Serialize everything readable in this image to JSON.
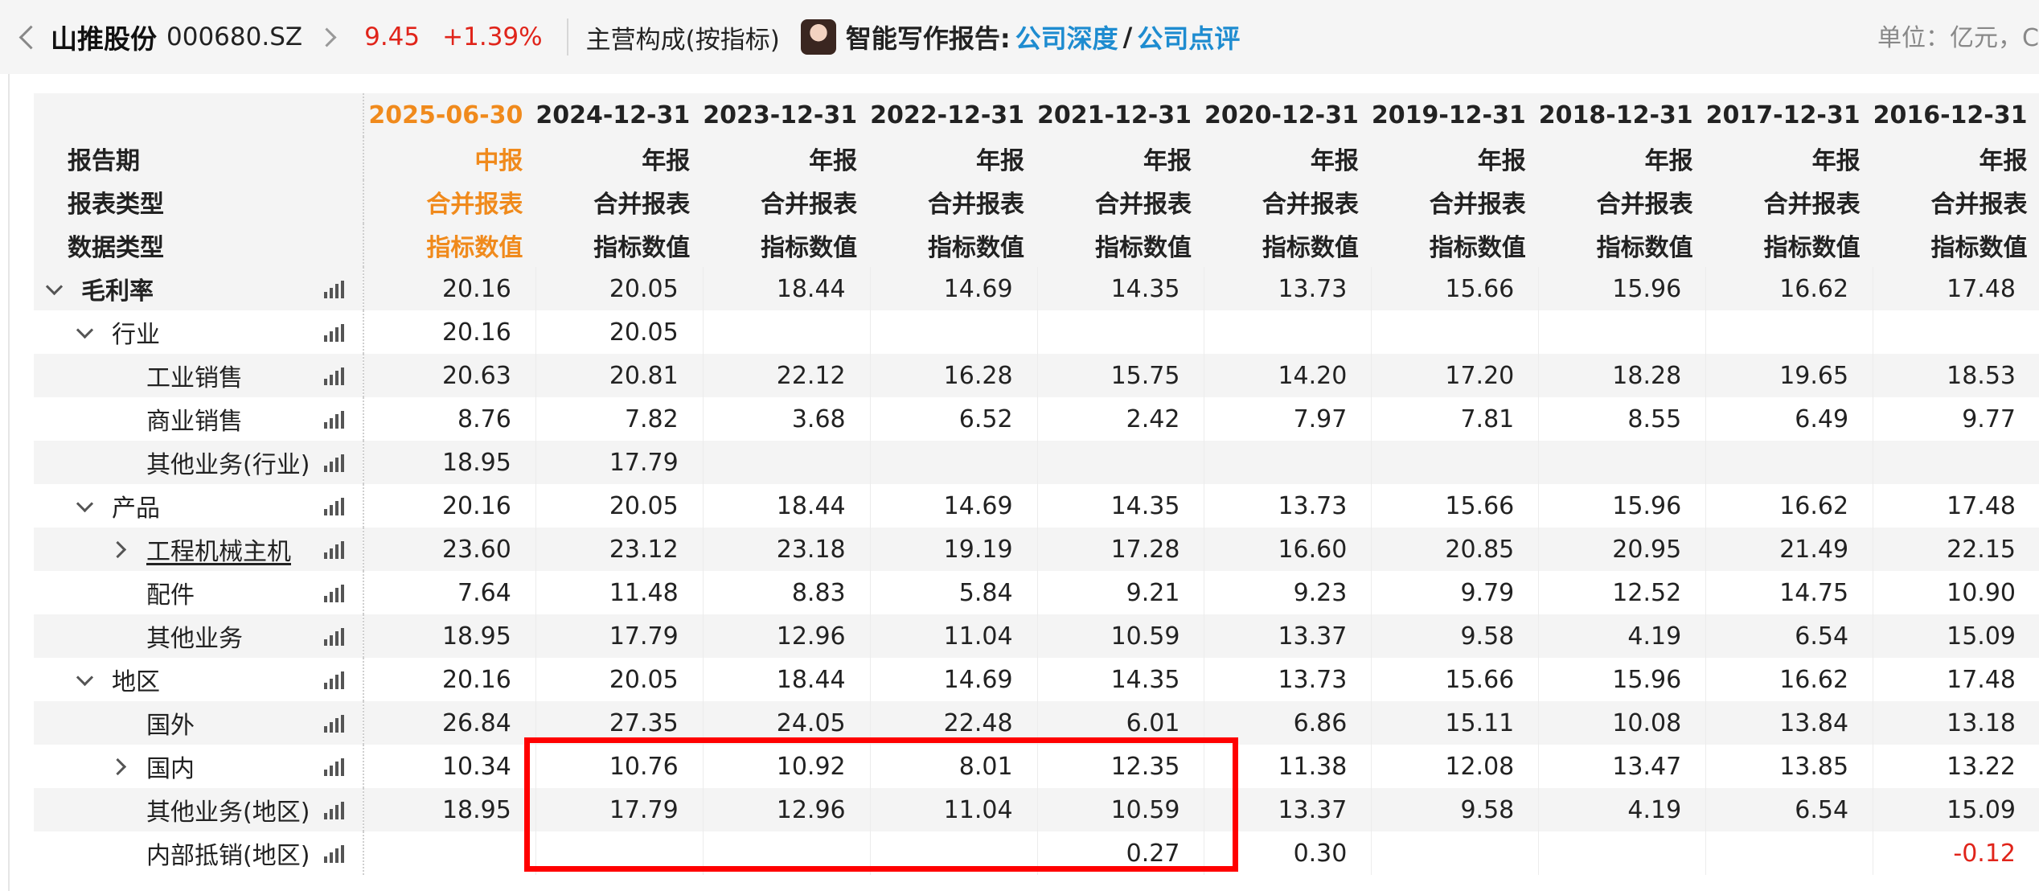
{
  "header": {
    "stock_name": "山推股份",
    "stock_code": "000680.SZ",
    "price": "9.45",
    "change_pct": "+1.39%",
    "section_title": "主营构成(按指标)",
    "ai_report_label": "智能写作报告:",
    "ai_link_1": "公司深度",
    "ai_slash": "/",
    "ai_link_2": "公司点评",
    "unit": "单位：亿元，C"
  },
  "table": {
    "row_labels": [
      "报告期",
      "报表类型",
      "数据类型"
    ],
    "periods": [
      {
        "date": "2025-06-30",
        "type": "中报",
        "statement": "合并报表",
        "data_type": "指标数值"
      },
      {
        "date": "2024-12-31",
        "type": "年报",
        "statement": "合并报表",
        "data_type": "指标数值"
      },
      {
        "date": "2023-12-31",
        "type": "年报",
        "statement": "合并报表",
        "data_type": "指标数值"
      },
      {
        "date": "2022-12-31",
        "type": "年报",
        "statement": "合并报表",
        "data_type": "指标数值"
      },
      {
        "date": "2021-12-31",
        "type": "年报",
        "statement": "合并报表",
        "data_type": "指标数值"
      },
      {
        "date": "2020-12-31",
        "type": "年报",
        "statement": "合并报表",
        "data_type": "指标数值"
      },
      {
        "date": "2019-12-31",
        "type": "年报",
        "statement": "合并报表",
        "data_type": "指标数值"
      },
      {
        "date": "2018-12-31",
        "type": "年报",
        "statement": "合并报表",
        "data_type": "指标数值"
      },
      {
        "date": "2017-12-31",
        "type": "年报",
        "statement": "合并报表",
        "data_type": "指标数值"
      },
      {
        "date": "2016-12-31",
        "type": "年报",
        "statement": "合并报表",
        "data_type": "指标数值"
      }
    ],
    "rows": [
      {
        "name": "毛利率",
        "values": [
          "20.16",
          "20.05",
          "18.44",
          "14.69",
          "14.35",
          "13.73",
          "15.66",
          "15.96",
          "16.62",
          "17.48"
        ]
      },
      {
        "name": "行业",
        "values": [
          "20.16",
          "20.05",
          "",
          "",
          "",
          "",
          "",
          "",
          "",
          ""
        ]
      },
      {
        "name": "工业销售",
        "values": [
          "20.63",
          "20.81",
          "22.12",
          "16.28",
          "15.75",
          "14.20",
          "17.20",
          "18.28",
          "19.65",
          "18.53"
        ]
      },
      {
        "name": "商业销售",
        "values": [
          "8.76",
          "7.82",
          "3.68",
          "6.52",
          "2.42",
          "7.97",
          "7.81",
          "8.55",
          "6.49",
          "9.77"
        ]
      },
      {
        "name": "其他业务(行业)",
        "values": [
          "18.95",
          "17.79",
          "",
          "",
          "",
          "",
          "",
          "",
          "",
          ""
        ]
      },
      {
        "name": "产品",
        "values": [
          "20.16",
          "20.05",
          "18.44",
          "14.69",
          "14.35",
          "13.73",
          "15.66",
          "15.96",
          "16.62",
          "17.48"
        ]
      },
      {
        "name": "工程机械主机",
        "values": [
          "23.60",
          "23.12",
          "23.18",
          "19.19",
          "17.28",
          "16.60",
          "20.85",
          "20.95",
          "21.49",
          "22.15"
        ]
      },
      {
        "name": "配件",
        "values": [
          "7.64",
          "11.48",
          "8.83",
          "5.84",
          "9.21",
          "9.23",
          "9.79",
          "12.52",
          "14.75",
          "10.90"
        ]
      },
      {
        "name": "其他业务",
        "values": [
          "18.95",
          "17.79",
          "12.96",
          "11.04",
          "10.59",
          "13.37",
          "9.58",
          "4.19",
          "6.54",
          "15.09"
        ]
      },
      {
        "name": "地区",
        "values": [
          "20.16",
          "20.05",
          "18.44",
          "14.69",
          "14.35",
          "13.73",
          "15.66",
          "15.96",
          "16.62",
          "17.48"
        ]
      },
      {
        "name": "国外",
        "values": [
          "26.84",
          "27.35",
          "24.05",
          "22.48",
          "6.01",
          "6.86",
          "15.11",
          "10.08",
          "13.84",
          "13.18"
        ]
      },
      {
        "name": "国内",
        "values": [
          "10.34",
          "10.76",
          "10.92",
          "8.01",
          "12.35",
          "11.38",
          "12.08",
          "13.47",
          "13.85",
          "13.22"
        ]
      },
      {
        "name": "其他业务(地区)",
        "values": [
          "18.95",
          "17.79",
          "12.96",
          "11.04",
          "10.59",
          "13.37",
          "9.58",
          "4.19",
          "6.54",
          "15.09"
        ]
      },
      {
        "name": "内部抵销(地区)",
        "values": [
          "",
          "",
          "",
          "",
          "0.27",
          "0.30",
          "",
          "",
          "",
          "-0.12"
        ]
      }
    ]
  },
  "colors": {
    "accent_orange": "#f08a1c",
    "up_red": "#e0241a",
    "link_blue": "#1e8cd0",
    "highlight_box": "#ff0000"
  },
  "icons": {
    "row_chart": "bar-chart-icon",
    "expand": "chevron-down-icon",
    "collapse": "chevron-right-icon",
    "back": "chevron-left-icon"
  }
}
